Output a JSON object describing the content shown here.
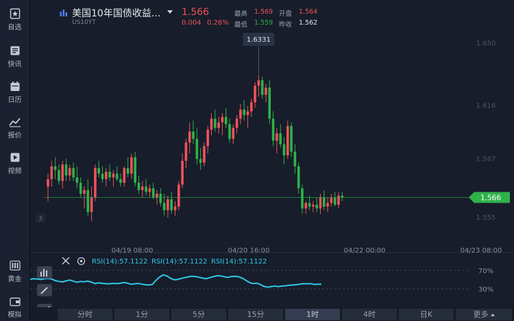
{
  "sidebar": {
    "items": [
      {
        "label": "自选",
        "icon": "star-icon"
      },
      {
        "label": "快讯",
        "icon": "news-icon"
      },
      {
        "label": "日历",
        "icon": "calendar-icon"
      },
      {
        "label": "报价",
        "icon": "trend-icon"
      },
      {
        "label": "视频",
        "icon": "play-icon"
      }
    ],
    "bottom_items": [
      {
        "label": "黄金",
        "icon": "gold-bars-icon"
      },
      {
        "label": "模拟",
        "icon": "wallet-icon"
      }
    ]
  },
  "header": {
    "title": "美国10年国债收益...",
    "code": "US10YT",
    "price": "1.566",
    "change": "0.004",
    "change_pct": "0.26%",
    "high_label": "最高",
    "high": "1.569",
    "open_label": "开盘",
    "open": "1.564",
    "low_label": "最低",
    "low": "1.559",
    "prev_label": "昨收",
    "prev": "1.562"
  },
  "colors": {
    "up": "#f0525b",
    "down": "#2fb24a",
    "rsi": "#2fc9e8",
    "price_tag": "#2fb24a",
    "background": "#171d2a"
  },
  "chart_data": {
    "type": "candlestick",
    "ylim": [
      1.543,
      1.657
    ],
    "y_ticks": [
      1.65,
      1.616,
      1.587,
      1.555
    ],
    "x_ticks": [
      "04/19 08:00",
      "04/20 16:00",
      "04/22 00:00",
      "04/23 08:00"
    ],
    "current_price": "1.566",
    "max_marker": "1.6331",
    "corner_marker": "3",
    "candles": [
      [
        1.572,
        1.579,
        1.564,
        1.576
      ],
      [
        1.576,
        1.586,
        1.572,
        1.583
      ],
      [
        1.583,
        1.588,
        1.576,
        1.581
      ],
      [
        1.581,
        1.584,
        1.573,
        1.575
      ],
      [
        1.575,
        1.586,
        1.571,
        1.584
      ],
      [
        1.584,
        1.587,
        1.575,
        1.578
      ],
      [
        1.578,
        1.584,
        1.575,
        1.582
      ],
      [
        1.582,
        1.585,
        1.575,
        1.577
      ],
      [
        1.577,
        1.583,
        1.571,
        1.574
      ],
      [
        1.574,
        1.577,
        1.566,
        1.568
      ],
      [
        1.568,
        1.572,
        1.56,
        1.57
      ],
      [
        1.57,
        1.576,
        1.556,
        1.558
      ],
      [
        1.558,
        1.572,
        1.553,
        1.566
      ],
      [
        1.566,
        1.584,
        1.564,
        1.582
      ],
      [
        1.582,
        1.586,
        1.577,
        1.579
      ],
      [
        1.579,
        1.583,
        1.574,
        1.576
      ],
      [
        1.576,
        1.582,
        1.572,
        1.58
      ],
      [
        1.58,
        1.584,
        1.575,
        1.577
      ],
      [
        1.577,
        1.581,
        1.572,
        1.579
      ],
      [
        1.579,
        1.583,
        1.575,
        1.576
      ],
      [
        1.576,
        1.579,
        1.572,
        1.574
      ],
      [
        1.574,
        1.583,
        1.572,
        1.582
      ],
      [
        1.582,
        1.588,
        1.577,
        1.579
      ],
      [
        1.579,
        1.59,
        1.576,
        1.588
      ],
      [
        1.588,
        1.591,
        1.572,
        1.574
      ],
      [
        1.574,
        1.578,
        1.568,
        1.57
      ],
      [
        1.57,
        1.575,
        1.566,
        1.572
      ],
      [
        1.572,
        1.576,
        1.567,
        1.569
      ],
      [
        1.569,
        1.573,
        1.566,
        1.571
      ],
      [
        1.571,
        1.574,
        1.565,
        1.566
      ],
      [
        1.566,
        1.57,
        1.562,
        1.568
      ],
      [
        1.568,
        1.571,
        1.561,
        1.563
      ],
      [
        1.563,
        1.568,
        1.556,
        1.559
      ],
      [
        1.559,
        1.567,
        1.555,
        1.565
      ],
      [
        1.565,
        1.569,
        1.557,
        1.559
      ],
      [
        1.559,
        1.564,
        1.556,
        1.561
      ],
      [
        1.561,
        1.575,
        1.559,
        1.573
      ],
      [
        1.573,
        1.59,
        1.571,
        1.586
      ],
      [
        1.586,
        1.598,
        1.582,
        1.596
      ],
      [
        1.596,
        1.607,
        1.59,
        1.602
      ],
      [
        1.602,
        1.608,
        1.595,
        1.598
      ],
      [
        1.598,
        1.604,
        1.584,
        1.587
      ],
      [
        1.587,
        1.593,
        1.581,
        1.585
      ],
      [
        1.585,
        1.596,
        1.583,
        1.594
      ],
      [
        1.594,
        1.605,
        1.59,
        1.603
      ],
      [
        1.603,
        1.612,
        1.6,
        1.609
      ],
      [
        1.609,
        1.614,
        1.602,
        1.604
      ],
      [
        1.604,
        1.61,
        1.601,
        1.607
      ],
      [
        1.607,
        1.612,
        1.6,
        1.61
      ],
      [
        1.61,
        1.615,
        1.604,
        1.606
      ],
      [
        1.606,
        1.609,
        1.596,
        1.598
      ],
      [
        1.598,
        1.606,
        1.595,
        1.604
      ],
      [
        1.604,
        1.611,
        1.601,
        1.609
      ],
      [
        1.609,
        1.617,
        1.606,
        1.614
      ],
      [
        1.614,
        1.619,
        1.608,
        1.611
      ],
      [
        1.611,
        1.616,
        1.604,
        1.613
      ],
      [
        1.613,
        1.62,
        1.61,
        1.618
      ],
      [
        1.618,
        1.629,
        1.615,
        1.627
      ],
      [
        1.627,
        1.633,
        1.621,
        1.63
      ],
      [
        1.63,
        1.632,
        1.62,
        1.622
      ],
      [
        1.622,
        1.628,
        1.618,
        1.626
      ],
      [
        1.626,
        1.63,
        1.606,
        1.609
      ],
      [
        1.609,
        1.613,
        1.594,
        1.597
      ],
      [
        1.597,
        1.604,
        1.59,
        1.601
      ],
      [
        1.601,
        1.606,
        1.593,
        1.595
      ],
      [
        1.595,
        1.599,
        1.584,
        1.589
      ],
      [
        1.589,
        1.608,
        1.587,
        1.605
      ],
      [
        1.605,
        1.607,
        1.588,
        1.591
      ],
      [
        1.591,
        1.595,
        1.579,
        1.583
      ],
      [
        1.583,
        1.585,
        1.568,
        1.571
      ],
      [
        1.571,
        1.573,
        1.557,
        1.56
      ],
      [
        1.56,
        1.564,
        1.557,
        1.563
      ],
      [
        1.563,
        1.567,
        1.559,
        1.561
      ],
      [
        1.561,
        1.564,
        1.558,
        1.562
      ],
      [
        1.562,
        1.566,
        1.558,
        1.56
      ],
      [
        1.56,
        1.568,
        1.557,
        1.566
      ],
      [
        1.566,
        1.57,
        1.559,
        1.561
      ],
      [
        1.561,
        1.566,
        1.558,
        1.563
      ],
      [
        1.563,
        1.568,
        1.561,
        1.566
      ],
      [
        1.566,
        1.569,
        1.561,
        1.562
      ],
      [
        1.562,
        1.569,
        1.56,
        1.567
      ],
      [
        1.567,
        1.569,
        1.564,
        1.566
      ]
    ],
    "rsi": {
      "label": "RSI(14):57.1122",
      "labels": [
        "RSI(14):57.1122",
        "RSI(14):57.1122",
        "RSI(14):57.1122"
      ],
      "levels": [
        "70%",
        "30%"
      ],
      "ylim": [
        0,
        100
      ],
      "values": [
        60,
        62,
        61,
        59,
        62,
        63,
        61,
        55,
        52,
        50,
        54,
        57,
        53,
        49,
        52,
        51,
        53,
        50,
        44,
        47,
        45,
        44,
        43,
        45,
        44,
        45,
        48,
        46,
        42,
        43,
        45,
        42,
        40,
        39,
        41,
        56,
        68,
        76,
        72,
        64,
        58,
        59,
        63,
        66,
        69,
        71,
        70,
        67,
        64,
        62,
        66,
        70,
        73,
        72,
        69,
        67,
        70,
        71,
        69,
        64,
        56,
        48,
        44,
        46,
        41,
        34,
        31,
        33,
        35,
        33,
        35,
        36,
        38,
        39,
        40,
        42,
        44,
        43,
        44,
        41,
        42,
        42
      ]
    }
  },
  "rsi_panel": {
    "close_icon": "close-icon",
    "settings_icon": "settings-icon"
  },
  "periods": [
    "分时",
    "1分",
    "5分",
    "15分",
    "1时",
    "4时",
    "日K",
    "更多"
  ],
  "active_period": "1时"
}
